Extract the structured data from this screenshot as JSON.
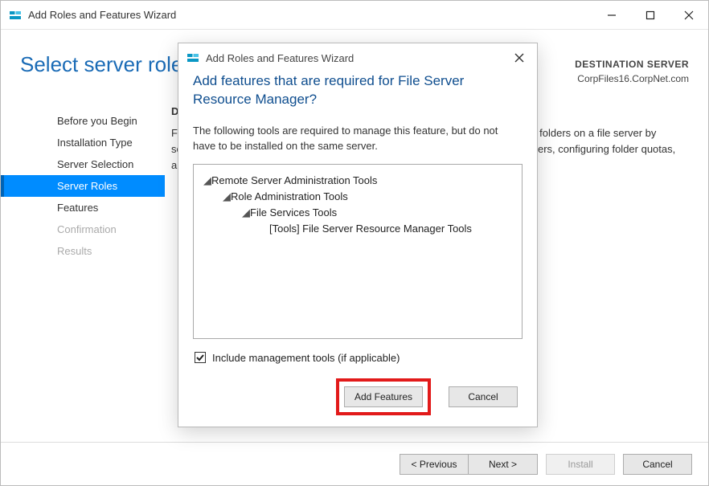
{
  "window": {
    "title": "Add Roles and Features Wizard"
  },
  "header": {
    "page_title": "Select server roles",
    "destination_label": "DESTINATION SERVER",
    "destination_name": "CorpFiles16.CorpNet.com"
  },
  "nav": {
    "items": [
      {
        "label": "Before you Begin",
        "state": "normal"
      },
      {
        "label": "Installation Type",
        "state": "normal"
      },
      {
        "label": "Server Selection",
        "state": "normal"
      },
      {
        "label": "Server Roles",
        "state": "active"
      },
      {
        "label": "Features",
        "state": "normal"
      },
      {
        "label": "Confirmation",
        "state": "disabled"
      },
      {
        "label": "Results",
        "state": "disabled"
      }
    ]
  },
  "body": {
    "description_heading": "Description",
    "description_text": "File Server Resource Manager helps you manage and understand the files and folders on a file server by scheduling file management tasks and storage reports, classifying files and folders, configuring folder quotas, and defining file screening policies."
  },
  "footer": {
    "previous_label": "< Previous",
    "next_label": "Next >",
    "install_label": "Install",
    "cancel_label": "Cancel"
  },
  "dialog": {
    "title": "Add Roles and Features Wizard",
    "headline": "Add features that are required for File Server Resource Manager?",
    "text": "The following tools are required to manage this feature, but do not have to be installed on the same server.",
    "tree": [
      {
        "indent": 0,
        "expandable": true,
        "label": "Remote Server Administration Tools"
      },
      {
        "indent": 1,
        "expandable": true,
        "label": "Role Administration Tools"
      },
      {
        "indent": 2,
        "expandable": true,
        "label": "File Services Tools"
      },
      {
        "indent": 3,
        "expandable": false,
        "label": "[Tools] File Server Resource Manager Tools"
      }
    ],
    "include_tools_label": "Include management tools (if applicable)",
    "include_tools_checked": true,
    "add_label": "Add Features",
    "cancel_label": "Cancel"
  }
}
